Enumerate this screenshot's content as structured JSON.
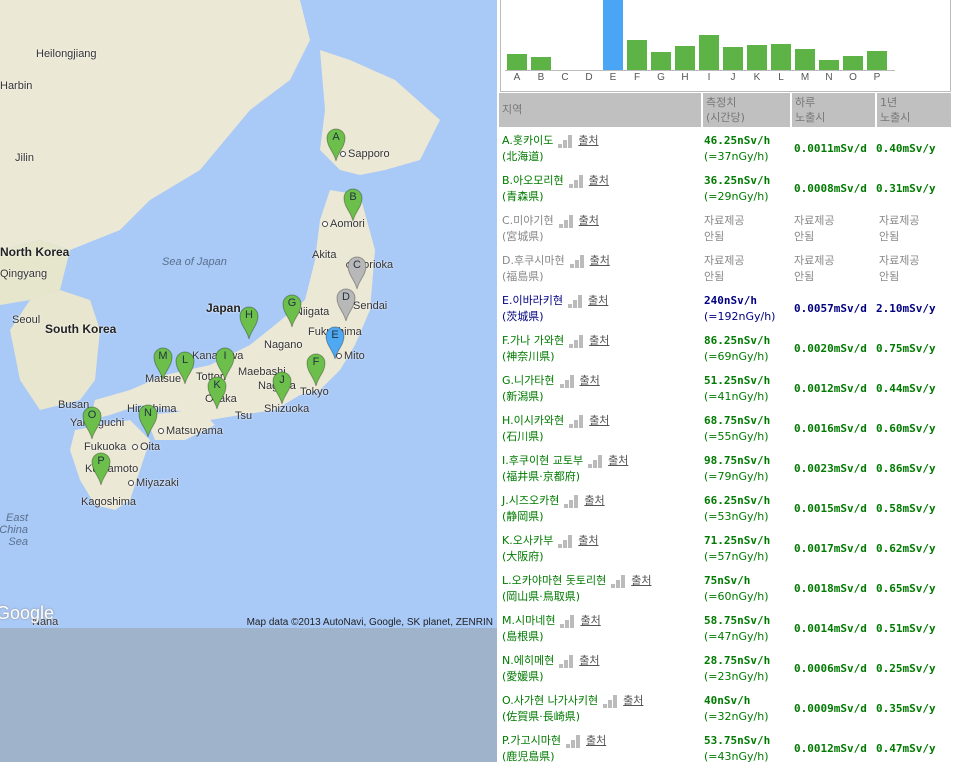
{
  "map": {
    "attribution": "Map data ©2013 AutoNavi, Google, SK planet, ZENRIN",
    "google_logo": "Google",
    "countries": [
      "North Korea",
      "South Korea",
      "Japan"
    ],
    "seas": [
      "Sea of Japan",
      "East China Sea"
    ],
    "cities": [
      "Heilongjiang",
      "Harbin",
      "Jilin",
      "Seoul",
      "Busan",
      "Sapporo",
      "Aomori",
      "Akita",
      "Morioka",
      "Sendai",
      "Fukushima",
      "Niigata",
      "Nagano",
      "Mito",
      "Maebashi",
      "Tokyo",
      "Nagoya",
      "Shizuoka",
      "Kanazawa",
      "Tottori",
      "Matsue",
      "Osaka",
      "Tsu",
      "Hiroshima",
      "Yamaguchi",
      "Matsuyama",
      "Fukuoka",
      "Oita",
      "Kumamoto",
      "Miyazaki",
      "Kagoshima",
      "Naha",
      "Qingyang"
    ],
    "markers": [
      {
        "label": "A",
        "color": "#6cbf4a"
      },
      {
        "label": "B",
        "color": "#6cbf4a"
      },
      {
        "label": "C",
        "color": "#b8b8b8"
      },
      {
        "label": "D",
        "color": "#b8b8b8"
      },
      {
        "label": "E",
        "color": "#4ea9f2"
      },
      {
        "label": "F",
        "color": "#6cbf4a"
      },
      {
        "label": "G",
        "color": "#6cbf4a"
      },
      {
        "label": "H",
        "color": "#6cbf4a"
      },
      {
        "label": "I",
        "color": "#6cbf4a"
      },
      {
        "label": "J",
        "color": "#6cbf4a"
      },
      {
        "label": "K",
        "color": "#6cbf4a"
      },
      {
        "label": "L",
        "color": "#6cbf4a"
      },
      {
        "label": "M",
        "color": "#6cbf4a"
      },
      {
        "label": "N",
        "color": "#6cbf4a"
      },
      {
        "label": "O",
        "color": "#6cbf4a"
      },
      {
        "label": "P",
        "color": "#6cbf4a"
      }
    ]
  },
  "chart_data": {
    "type": "bar",
    "categories": [
      "A",
      "B",
      "C",
      "D",
      "E",
      "F",
      "G",
      "H",
      "I",
      "J",
      "K",
      "L",
      "M",
      "N",
      "O",
      "P"
    ],
    "values": [
      46.25,
      36.25,
      0,
      0,
      240,
      86.25,
      51.25,
      68.75,
      98.75,
      66.25,
      71.25,
      75,
      58.75,
      28.75,
      40,
      53.75
    ],
    "unit": "nSv/h",
    "highlight": "E",
    "colors": {
      "normal": "#5db346",
      "highlight": "#4aa6f5"
    }
  },
  "table": {
    "headers": [
      "지역",
      "측정치\n(시간당)",
      "하루\n노출시",
      "1년\n노출시"
    ],
    "source_label": "출처",
    "colors": {
      "green": "#007a00",
      "blue": "#000080",
      "gray": "#888888"
    },
    "rows": [
      {
        "name": "A.홋카이도",
        "kanji": "(北海道)",
        "rate": "46.25nSv/h",
        "gy": "(=37nGy/h)",
        "day": "0.0011mSv/d",
        "year": "0.40mSv/y",
        "status": "green"
      },
      {
        "name": "B.아오모리현",
        "kanji": "(青森県)",
        "rate": "36.25nSv/h",
        "gy": "(=29nGy/h)",
        "day": "0.0008mSv/d",
        "year": "0.31mSv/y",
        "status": "green"
      },
      {
        "name": "C.미야기현",
        "kanji": "(宮城県)",
        "rate": "자료제공",
        "gy": "안됨",
        "day": "자료제공\n안됨",
        "year": "자료제공\n안됨",
        "status": "gray"
      },
      {
        "name": "D.후쿠시마현",
        "kanji": "(福島県)",
        "rate": "자료제공",
        "gy": "안됨",
        "day": "자료제공\n안됨",
        "year": "자료제공\n안됨",
        "status": "gray"
      },
      {
        "name": "E.이바라키현",
        "kanji": "(茨城県)",
        "rate": "240nSv/h",
        "gy": "(=192nGy/h)",
        "day": "0.0057mSv/d",
        "year": "2.10mSv/y",
        "status": "blue"
      },
      {
        "name": "F.가나 가와현",
        "kanji": "(神奈川県)",
        "rate": "86.25nSv/h",
        "gy": "(=69nGy/h)",
        "day": "0.0020mSv/d",
        "year": "0.75mSv/y",
        "status": "green"
      },
      {
        "name": "G.니가타현",
        "kanji": "(新潟県)",
        "rate": "51.25nSv/h",
        "gy": "(=41nGy/h)",
        "day": "0.0012mSv/d",
        "year": "0.44mSv/y",
        "status": "green"
      },
      {
        "name": "H.이시카와현",
        "kanji": "(石川県)",
        "rate": "68.75nSv/h",
        "gy": "(=55nGy/h)",
        "day": "0.0016mSv/d",
        "year": "0.60mSv/y",
        "status": "green"
      },
      {
        "name": "I.후쿠이현 교토부",
        "kanji": "(福井県·京都府)",
        "rate": "98.75nSv/h",
        "gy": "(=79nGy/h)",
        "day": "0.0023mSv/d",
        "year": "0.86mSv/y",
        "status": "green"
      },
      {
        "name": "J.시즈오카현",
        "kanji": "(静岡県)",
        "rate": "66.25nSv/h",
        "gy": "(=53nGy/h)",
        "day": "0.0015mSv/d",
        "year": "0.58mSv/y",
        "status": "green"
      },
      {
        "name": "K.오사카부",
        "kanji": "(大阪府)",
        "rate": "71.25nSv/h",
        "gy": "(=57nGy/h)",
        "day": "0.0017mSv/d",
        "year": "0.62mSv/y",
        "status": "green"
      },
      {
        "name": "L.오카야마현 돗토리현",
        "kanji": "(岡山県·鳥取県)",
        "rate": "75nSv/h",
        "gy": "(=60nGy/h)",
        "day": "0.0018mSv/d",
        "year": "0.65mSv/y",
        "status": "green"
      },
      {
        "name": "M.시마네현",
        "kanji": "(島根県)",
        "rate": "58.75nSv/h",
        "gy": "(=47nGy/h)",
        "day": "0.0014mSv/d",
        "year": "0.51mSv/y",
        "status": "green"
      },
      {
        "name": "N.에히메현",
        "kanji": "(愛媛県)",
        "rate": "28.75nSv/h",
        "gy": "(=23nGy/h)",
        "day": "0.0006mSv/d",
        "year": "0.25mSv/y",
        "status": "green"
      },
      {
        "name": "O.사가현 나가사키현",
        "kanji": "(佐賀県·長崎県)",
        "rate": "40nSv/h",
        "gy": "(=32nGy/h)",
        "day": "0.0009mSv/d",
        "year": "0.35mSv/y",
        "status": "green"
      },
      {
        "name": "P.가고시마현",
        "kanji": "(鹿児島県)",
        "rate": "53.75nSv/h",
        "gy": "(=43nGy/h)",
        "day": "0.0012mSv/d",
        "year": "0.47mSv/y",
        "status": "green"
      }
    ]
  }
}
